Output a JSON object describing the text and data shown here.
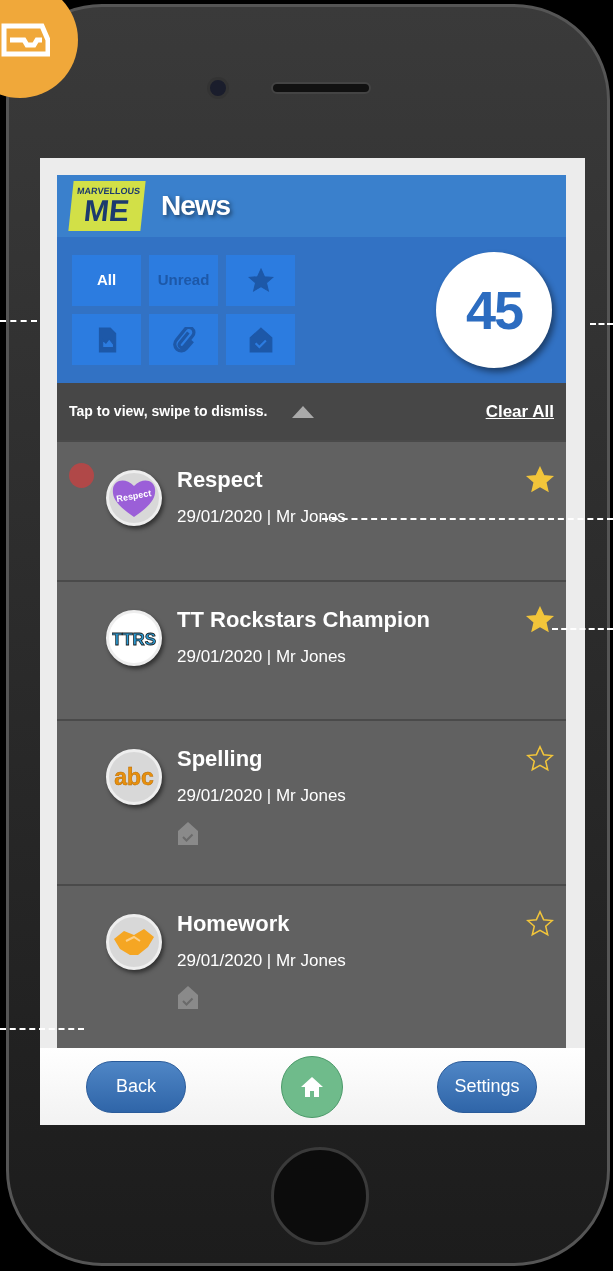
{
  "app_bar": {
    "logo": {
      "top": "MARVELLOUS",
      "main": "ME"
    },
    "title": "News"
  },
  "filters": [
    {
      "kind": "text",
      "label": "All",
      "selected": true
    },
    {
      "kind": "text",
      "label": "Unread",
      "selected": false
    },
    {
      "kind": "icon",
      "selected": false
    },
    {
      "kind": "icon",
      "selected": false
    },
    {
      "kind": "icon",
      "selected": false
    },
    {
      "kind": "icon",
      "selected": false
    }
  ],
  "count": "45",
  "hint_bar": {
    "text": "Tap to view, swipe to dismiss.",
    "expanded": false,
    "clear": "Clear All"
  },
  "messages": [
    {
      "title": "Respect",
      "meta": "29/01/2020 | Mr Jones",
      "unread": true,
      "starred": true,
      "homework": false,
      "badge": {
        "kind": "heart",
        "text": "Respect"
      }
    },
    {
      "title": "TT Rockstars Champion",
      "meta": "29/01/2020 | Mr Jones",
      "unread": false,
      "starred": true,
      "homework": false,
      "badge": {
        "kind": "ttrs",
        "text": "TTRS"
      }
    },
    {
      "title": "Spelling",
      "meta": "29/01/2020 | Mr Jones",
      "unread": false,
      "starred": false,
      "homework": true,
      "badge": {
        "kind": "abc",
        "text": "abc"
      }
    },
    {
      "title": "Homework",
      "meta": "29/01/2020 | Mr Jones",
      "unread": false,
      "starred": false,
      "homework": true,
      "badge": {
        "kind": "hands"
      }
    }
  ],
  "footer": {
    "back": "Back",
    "settings": "Settings"
  }
}
